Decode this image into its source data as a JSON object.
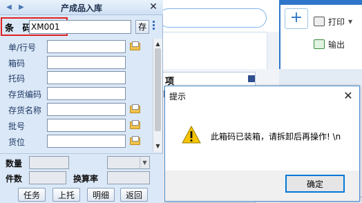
{
  "window": {
    "title": "产成品入库"
  },
  "barcode": {
    "label": "条 码",
    "value": "XM001",
    "stock_button": "存"
  },
  "fields": [
    {
      "label": "单/行号"
    },
    {
      "label": "箱码"
    },
    {
      "label": "托码"
    },
    {
      "label": "存货编码"
    },
    {
      "label": "存货名称"
    },
    {
      "label": "批号"
    },
    {
      "label": "货位"
    }
  ],
  "bottom": {
    "quantity_label": "数量",
    "pieces_label": "件数",
    "rate_label": "换算率"
  },
  "buttons": {
    "task": "任务",
    "pallet": "上托",
    "detail": "明细",
    "back": "返回"
  },
  "background": {
    "panel_title": "项",
    "print_label": "打印",
    "export_label": "输出",
    "accent_color": "#2d76c9"
  },
  "dialog": {
    "title": "提示",
    "message": "此箱码已装箱，请拆卸后再操作! \\n",
    "ok_label": "确定",
    "icon": "warning-icon"
  }
}
